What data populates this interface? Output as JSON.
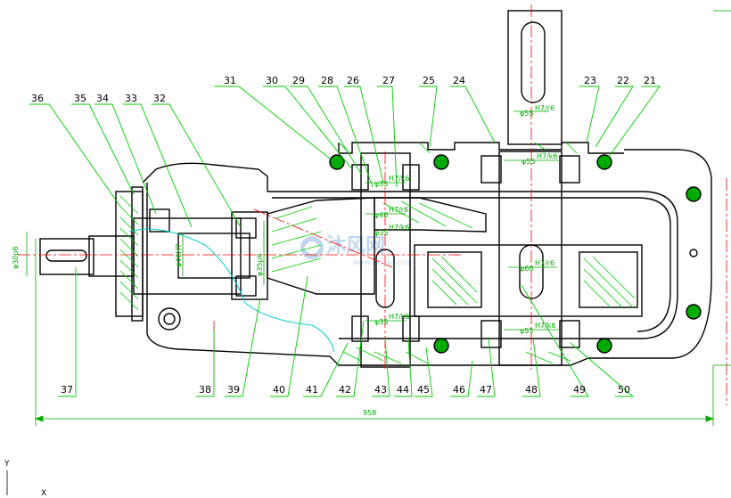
{
  "drawing": {
    "background": "#ffffff",
    "colors": {
      "outline": "#000000",
      "leader": "#00cc00",
      "dimension": "#00aa00",
      "centerline": "#ff0000",
      "hatch": "#00cc00",
      "break_line": "#00cccc",
      "part_fill": "#ffffff"
    },
    "callouts_top": [
      "31",
      "30",
      "29",
      "28",
      "26",
      "27",
      "25",
      "24",
      "23",
      "22",
      "21"
    ],
    "callouts_left": [
      "36",
      "35",
      "34",
      "33",
      "32"
    ],
    "callouts_bottom": [
      "37",
      "38",
      "39",
      "40",
      "41",
      "42",
      "43",
      "44",
      "45",
      "46",
      "47",
      "48",
      "49",
      "50"
    ],
    "overall_dimension": "958",
    "shaft_dims": {
      "input": "φ30p6",
      "input_bore": "φ40H7",
      "bearing_seat": "φ35p6",
      "top_seat": "φ55",
      "top_fit": "H7/r6",
      "output_seat": "φ55",
      "output_fit": "H7/k6",
      "mid_seat1": "φ35",
      "mid_seat1_fit": "H7/k6",
      "mid_seat2": "φ40",
      "mid_seat2_fit": "H7/r6",
      "mid_seat3": "φ35",
      "mid_seat3_fit": "H7/k6",
      "low_seat": "φ60",
      "low_fit": "H7/r6",
      "low_seat2": "φ55",
      "low_fit2": "H7/k6",
      "right_seat": "φ35",
      "right_fit": "H7/k6"
    },
    "watermark": {
      "main": "沐风网",
      "sub": "www.mfcad.com",
      "icon": "mufeng-logo-icon"
    },
    "axis_labels": {
      "y": "Y",
      "x": "X"
    }
  }
}
